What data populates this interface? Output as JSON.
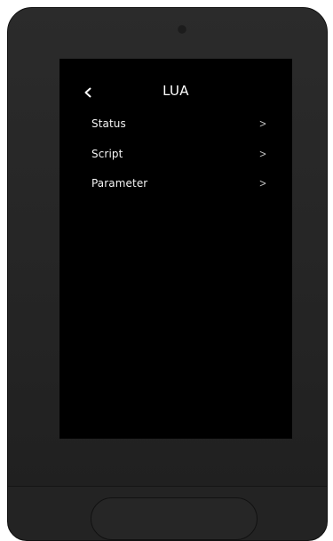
{
  "screen": {
    "title": "LUA",
    "back_icon": "chevron-left-icon",
    "items": [
      {
        "label": "Status",
        "chevron": ">"
      },
      {
        "label": "Script",
        "chevron": ">"
      },
      {
        "label": "Parameter",
        "chevron": ">"
      }
    ]
  },
  "colors": {
    "bezel": "#252525",
    "screen_bg": "#000000",
    "text": "#f5f5f5"
  }
}
